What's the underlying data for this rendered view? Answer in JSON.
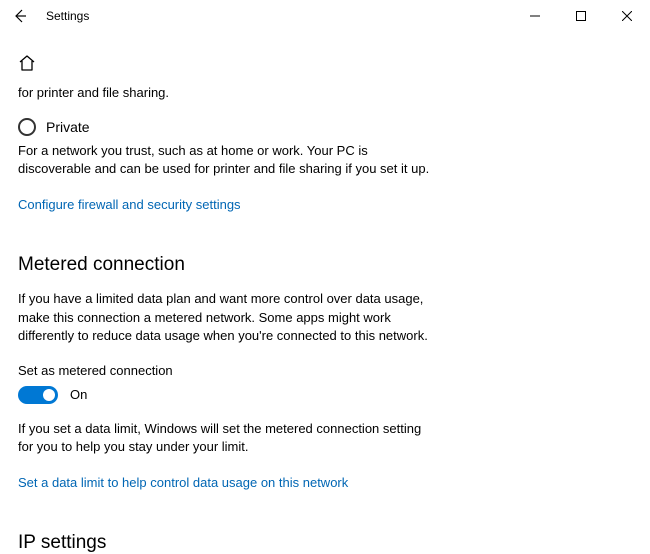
{
  "titlebar": {
    "title": "Settings"
  },
  "truncated_top_text": "for printer and file sharing.",
  "network_profile": {
    "private_label": "Private",
    "private_desc": "For a network you trust, such as at home or work. Your PC is discoverable and can be used for printer and file sharing if you set it up.",
    "firewall_link": "Configure firewall and security settings"
  },
  "metered": {
    "heading": "Metered connection",
    "desc": "If you have a limited data plan and want more control over data usage, make this connection a metered network. Some apps might work differently to reduce data usage when you're connected to this network.",
    "toggle_label": "Set as metered connection",
    "toggle_state": "On",
    "below_desc": "If you set a data limit, Windows will set the metered connection setting for you to help you stay under your limit.",
    "data_limit_link": "Set a data limit to help control data usage on this network"
  },
  "ip": {
    "heading": "IP settings"
  }
}
